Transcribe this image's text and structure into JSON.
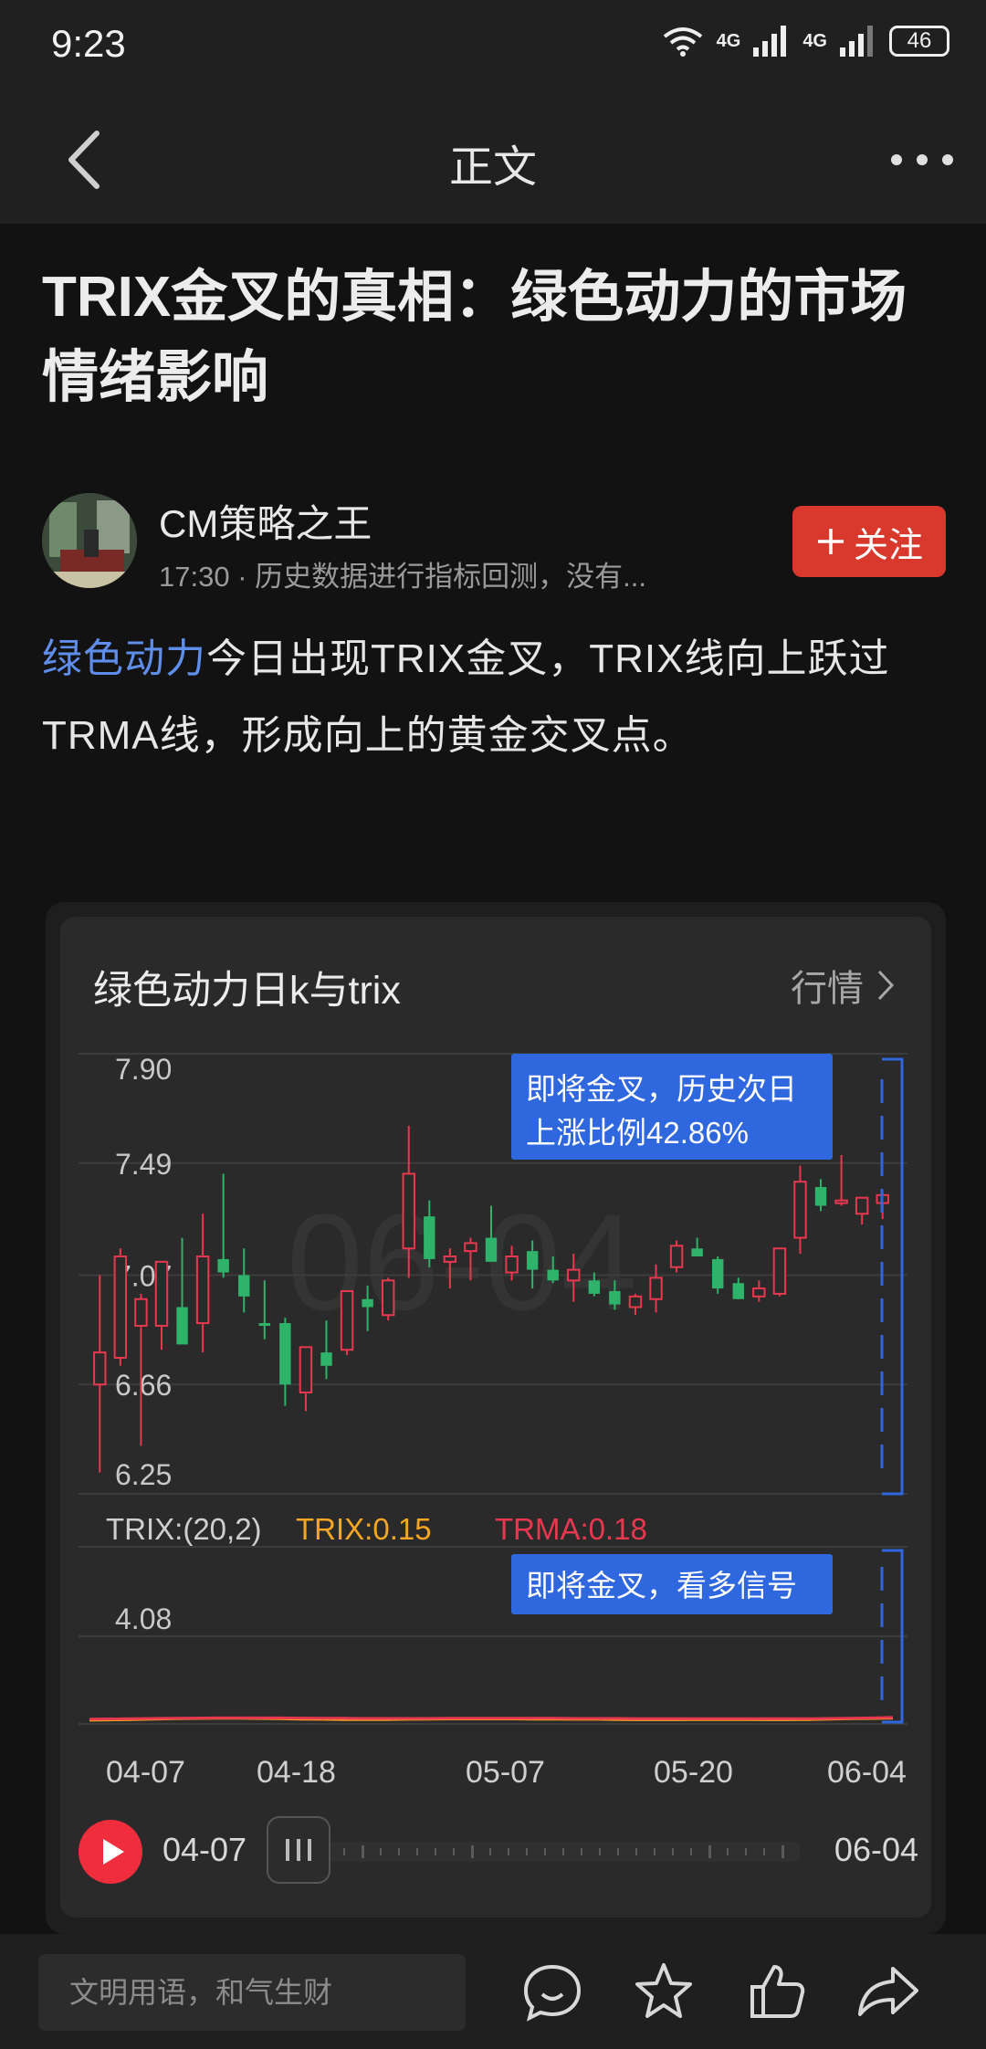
{
  "status_bar": {
    "time": "9:23",
    "network1": "4G",
    "network2": "4G",
    "battery": "46"
  },
  "nav": {
    "title": "正文"
  },
  "article": {
    "title": "TRIX金叉的真相：绿色动力的市场情绪影响",
    "author_name": "CM策略之王",
    "author_meta": "17:30 · 历史数据进行指标回测，没有...",
    "follow_label": "关注",
    "body_link": "绿色动力",
    "body_text": "今日出现TRIX金叉，TRIX线向上跃过TRMA线，形成向上的黄金交叉点。"
  },
  "card": {
    "title": "绿色动力日k与trix",
    "link_label": "行情",
    "watermark": "06-04",
    "price_annotation_line1": "即将金叉，历史次日",
    "price_annotation_line2": "上涨比例42.86%",
    "trix_annotation": "即将金叉，看多信号",
    "trix_param": "TRIX:(20,2)",
    "trix_value": "TRIX:0.15",
    "trma_value": "TRMA:0.18",
    "timeline_start": "04-07",
    "timeline_end": "06-04"
  },
  "colors": {
    "up": "#e8384f",
    "down": "#2fb36a",
    "trix": "#f5a623",
    "trma": "#e8384f",
    "accent": "#2f67df",
    "follow": "#d9382d"
  },
  "chart_data": [
    {
      "type": "candlestick",
      "title": "绿色动力日k与trix",
      "ylim": [
        6.25,
        7.9
      ],
      "y_ticks": [
        "7.90",
        "7.49",
        "7.07",
        "6.66",
        "6.25"
      ],
      "x_tick_labels": [
        "04-07",
        "04-18",
        "05-07",
        "05-20",
        "06-04"
      ],
      "candles": [
        {
          "o": 6.66,
          "h": 7.07,
          "l": 6.33,
          "c": 6.78
        },
        {
          "o": 6.76,
          "h": 7.17,
          "l": 6.73,
          "c": 7.14
        },
        {
          "o": 6.88,
          "h": 7.0,
          "l": 6.43,
          "c": 6.98
        },
        {
          "o": 6.88,
          "h": 7.11,
          "l": 6.79,
          "c": 7.12
        },
        {
          "o": 6.95,
          "h": 7.21,
          "l": 6.82,
          "c": 6.81
        },
        {
          "o": 6.89,
          "h": 7.3,
          "l": 6.78,
          "c": 7.14
        },
        {
          "o": 7.13,
          "h": 7.45,
          "l": 7.06,
          "c": 7.08
        },
        {
          "o": 7.07,
          "h": 7.17,
          "l": 6.93,
          "c": 6.99
        },
        {
          "o": 6.89,
          "h": 7.05,
          "l": 6.83,
          "c": 6.88
        },
        {
          "o": 6.89,
          "h": 6.91,
          "l": 6.58,
          "c": 6.66
        },
        {
          "o": 6.63,
          "h": 6.8,
          "l": 6.56,
          "c": 6.8
        },
        {
          "o": 6.78,
          "h": 6.9,
          "l": 6.68,
          "c": 6.73
        },
        {
          "o": 6.79,
          "h": 7.01,
          "l": 6.77,
          "c": 7.01
        },
        {
          "o": 6.98,
          "h": 7.03,
          "l": 6.86,
          "c": 6.95
        },
        {
          "o": 6.92,
          "h": 7.06,
          "l": 6.9,
          "c": 7.05
        },
        {
          "o": 7.17,
          "h": 7.63,
          "l": 7.06,
          "c": 7.45
        },
        {
          "o": 7.29,
          "h": 7.35,
          "l": 7.1,
          "c": 7.13
        },
        {
          "o": 7.12,
          "h": 7.17,
          "l": 7.02,
          "c": 7.14
        },
        {
          "o": 7.16,
          "h": 7.21,
          "l": 7.05,
          "c": 7.19
        },
        {
          "o": 7.21,
          "h": 7.33,
          "l": 7.12,
          "c": 7.12
        },
        {
          "o": 7.08,
          "h": 7.18,
          "l": 7.05,
          "c": 7.14
        },
        {
          "o": 7.16,
          "h": 7.2,
          "l": 7.02,
          "c": 7.09
        },
        {
          "o": 7.09,
          "h": 7.14,
          "l": 7.04,
          "c": 7.05
        },
        {
          "o": 7.05,
          "h": 7.15,
          "l": 6.97,
          "c": 7.09
        },
        {
          "o": 7.05,
          "h": 7.08,
          "l": 6.99,
          "c": 7.0
        },
        {
          "o": 7.01,
          "h": 7.05,
          "l": 6.94,
          "c": 6.96
        },
        {
          "o": 6.95,
          "h": 7.0,
          "l": 6.92,
          "c": 6.99
        },
        {
          "o": 6.98,
          "h": 7.11,
          "l": 6.93,
          "c": 7.06
        },
        {
          "o": 7.1,
          "h": 7.2,
          "l": 7.08,
          "c": 7.18
        },
        {
          "o": 7.17,
          "h": 7.21,
          "l": 7.14,
          "c": 7.14
        },
        {
          "o": 7.13,
          "h": 7.14,
          "l": 7.0,
          "c": 7.02
        },
        {
          "o": 7.04,
          "h": 7.06,
          "l": 6.98,
          "c": 6.98
        },
        {
          "o": 6.99,
          "h": 7.05,
          "l": 6.97,
          "c": 7.02
        },
        {
          "o": 7.0,
          "h": 7.17,
          "l": 6.99,
          "c": 7.17
        },
        {
          "o": 7.21,
          "h": 7.48,
          "l": 7.15,
          "c": 7.42
        },
        {
          "o": 7.4,
          "h": 7.43,
          "l": 7.31,
          "c": 7.33
        },
        {
          "o": 7.35,
          "h": 7.52,
          "l": 7.33,
          "c": 7.35
        },
        {
          "o": 7.3,
          "h": 7.36,
          "l": 7.26,
          "c": 7.36
        },
        {
          "o": 7.34,
          "h": 7.38,
          "l": 7.28,
          "c": 7.37
        }
      ]
    },
    {
      "type": "line",
      "y_ticks": [
        "4.08"
      ],
      "series": [
        {
          "name": "TRIX",
          "values": [
            0.05,
            0.06,
            0.08,
            0.1,
            0.12,
            0.13,
            0.14,
            0.14,
            0.13,
            0.12,
            0.1,
            0.09,
            0.08,
            0.08,
            0.08,
            0.09,
            0.1,
            0.11,
            0.11,
            0.11,
            0.11,
            0.1,
            0.1,
            0.09,
            0.09,
            0.08,
            0.07,
            0.07,
            0.07,
            0.08,
            0.08,
            0.08,
            0.07,
            0.07,
            0.08,
            0.1,
            0.12,
            0.13,
            0.15
          ]
        },
        {
          "name": "TRMA",
          "values": [
            0.1,
            0.11,
            0.12,
            0.13,
            0.14,
            0.15,
            0.16,
            0.16,
            0.16,
            0.16,
            0.15,
            0.14,
            0.14,
            0.13,
            0.13,
            0.13,
            0.13,
            0.14,
            0.14,
            0.14,
            0.14,
            0.14,
            0.14,
            0.13,
            0.13,
            0.13,
            0.12,
            0.12,
            0.12,
            0.12,
            0.12,
            0.12,
            0.12,
            0.12,
            0.12,
            0.13,
            0.14,
            0.16,
            0.18
          ]
        }
      ]
    }
  ]
}
